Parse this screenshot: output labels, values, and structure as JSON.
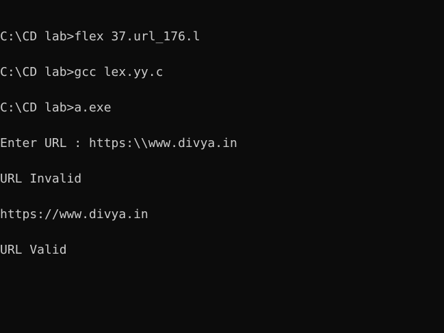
{
  "console": {
    "lines": [
      "C:\\CD lab>flex 37.url_176.l",
      "C:\\CD lab>gcc lex.yy.c",
      "C:\\CD lab>a.exe",
      "Enter URL : https:\\\\www.divya.in",
      "URL Invalid",
      "https://www.divya.in",
      "URL Valid"
    ]
  },
  "colors": {
    "background": "#0c0c0c",
    "text": "#cccccc"
  }
}
